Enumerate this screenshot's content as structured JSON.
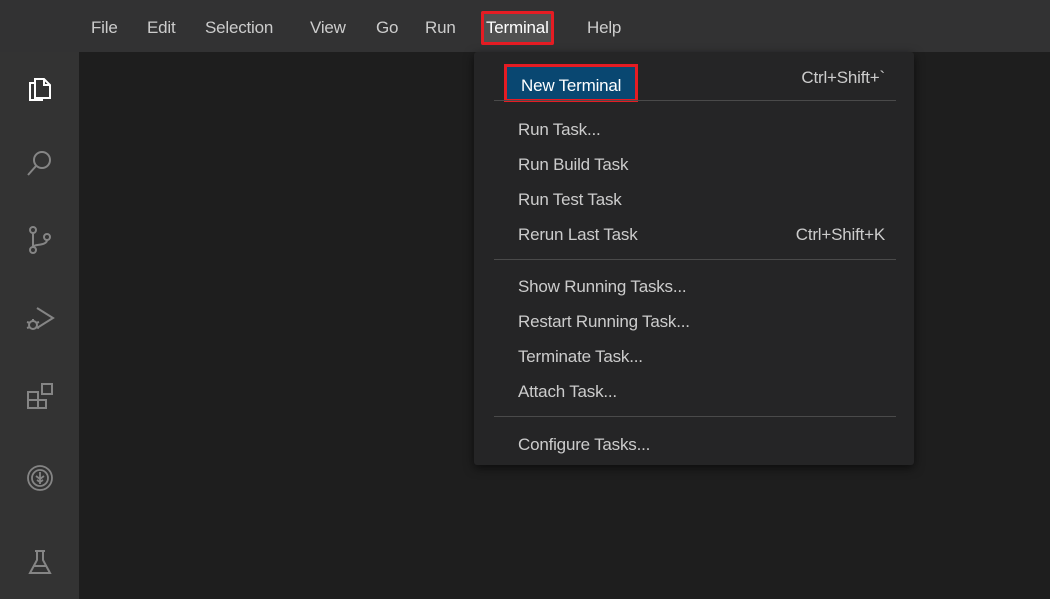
{
  "menubar": {
    "items": [
      {
        "label": "File",
        "icon": "file-menu"
      },
      {
        "label": "Edit"
      },
      {
        "label": "Selection"
      },
      {
        "label": "View"
      },
      {
        "label": "Go"
      },
      {
        "label": "Run"
      },
      {
        "label": "Terminal"
      },
      {
        "label": "Help"
      }
    ]
  },
  "activity_bar": {
    "icons": [
      "explorer-icon",
      "search-icon",
      "source-control-icon",
      "run-debug-icon",
      "extensions-icon",
      "tree-icon",
      "testing-icon"
    ]
  },
  "terminal_menu": {
    "groups": [
      [
        {
          "label": "New Terminal",
          "shortcut": "Ctrl+Shift+`"
        }
      ],
      [
        {
          "label": "Run Task...",
          "shortcut": ""
        },
        {
          "label": "Run Build Task",
          "shortcut": ""
        },
        {
          "label": "Run Test Task",
          "shortcut": ""
        },
        {
          "label": "Rerun Last Task",
          "shortcut": "Ctrl+Shift+K"
        }
      ],
      [
        {
          "label": "Show Running Tasks...",
          "shortcut": ""
        },
        {
          "label": "Restart Running Task...",
          "shortcut": ""
        },
        {
          "label": "Terminate Task...",
          "shortcut": ""
        },
        {
          "label": "Attach Task...",
          "shortcut": ""
        }
      ],
      [
        {
          "label": "Configure Tasks...",
          "shortcut": ""
        }
      ]
    ]
  },
  "colors": {
    "highlight_outline": "#e51c23",
    "menu_bg": "#252526",
    "menubar_bg": "#323233",
    "activity_bg": "#333333",
    "editor_bg": "#1e1e1e"
  }
}
